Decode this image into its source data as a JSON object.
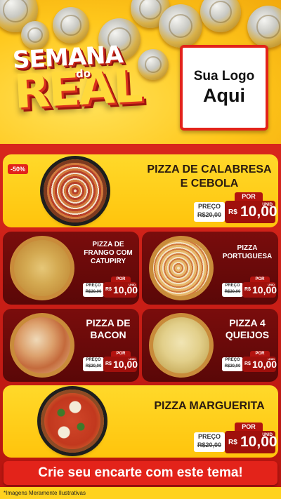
{
  "header": {
    "title_top": "SEMANA",
    "title_connector": "do",
    "title_main": "REAL",
    "logo_line1": "Sua Logo",
    "logo_line2": "Aqui"
  },
  "products": [
    {
      "name_line1": "PIZZA DE CALABRESA",
      "name_line2": "E CEBOLA",
      "badge": "-50%",
      "por_label": "POR",
      "preco_label": "PREÇO",
      "old_price": "R$20,00",
      "currency": "R$",
      "new_price": "10,00",
      "unit": "UNID"
    },
    {
      "name_line1": "PIZZA DE",
      "name_line2": "FRANGO COM",
      "name_line3": "CATUPIRY",
      "por_label": "POR",
      "preco_label": "PREÇO",
      "old_price": "R$20,00",
      "currency": "R$",
      "new_price": "10,00",
      "unit": "UNID"
    },
    {
      "name_line1": "PIZZA",
      "name_line2": "PORTUGUESA",
      "por_label": "POR",
      "preco_label": "PREÇO",
      "old_price": "R$20,00",
      "currency": "R$",
      "new_price": "10,00",
      "unit": "UNID"
    },
    {
      "name_line1": "PIZZA DE",
      "name_line2": "BACON",
      "por_label": "POR",
      "preco_label": "PREÇO",
      "old_price": "R$20,00",
      "currency": "R$",
      "new_price": "10,00",
      "unit": "UNID"
    },
    {
      "name_line1": "PIZZA 4",
      "name_line2": "QUEIJOS",
      "por_label": "POR",
      "preco_label": "PREÇO",
      "old_price": "R$20,00",
      "currency": "R$",
      "new_price": "10,00",
      "unit": "UNID"
    },
    {
      "name_line1": "PIZZA MARGUERITA",
      "por_label": "POR",
      "preco_label": "PREÇO",
      "old_price": "R$20,00",
      "currency": "R$",
      "new_price": "10,00",
      "unit": "UNID"
    }
  ],
  "cta_text": "Crie seu encarte com este tema!",
  "footnote": "*Imagens Meramente Ilustrativas",
  "colors": {
    "brand_red": "#e3231a",
    "brand_yellow": "#ffc81c",
    "dark_red": "#6a0a09"
  }
}
